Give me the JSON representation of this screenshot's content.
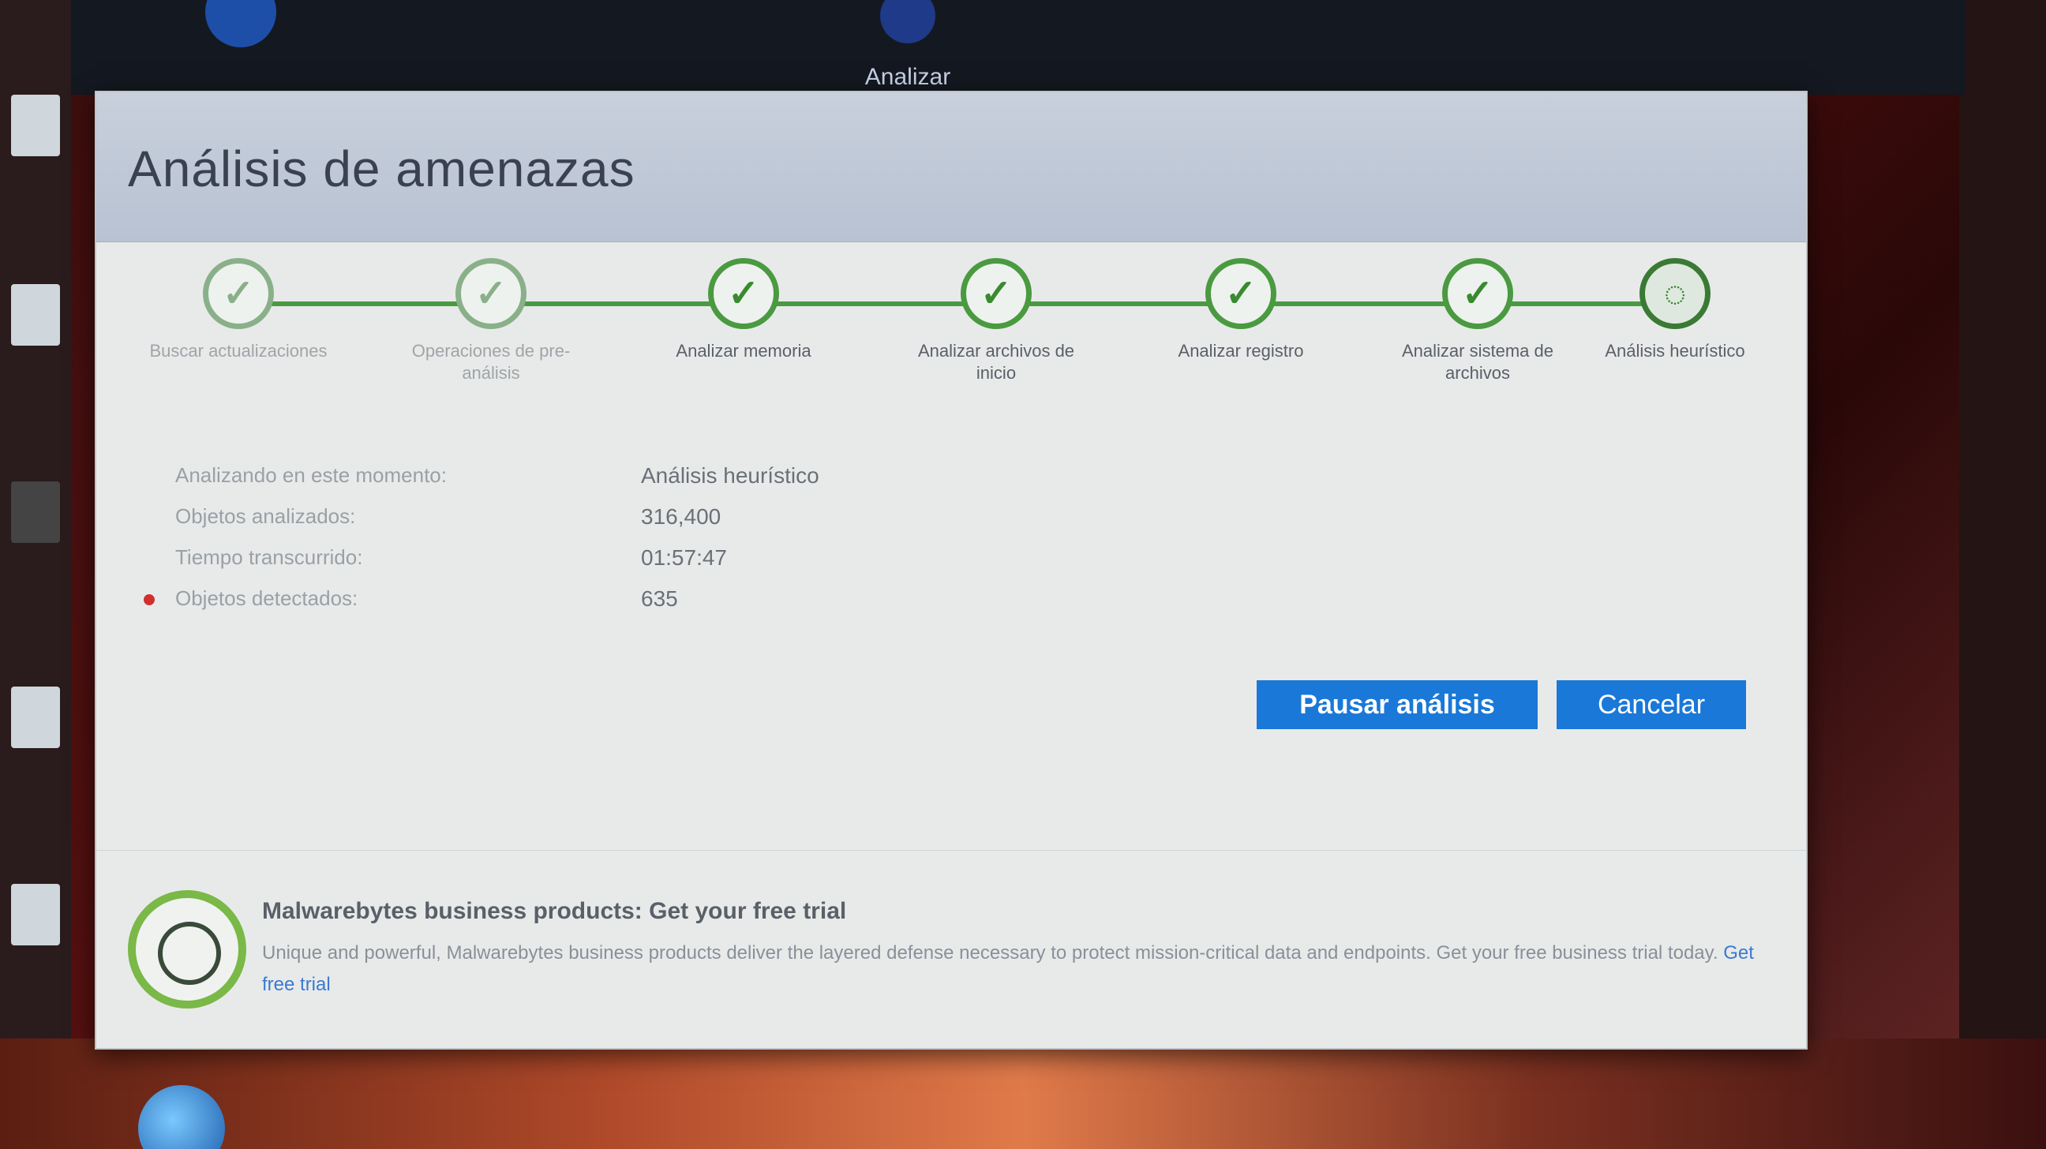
{
  "app": {
    "nav_scan_label": "Analizar"
  },
  "dialog": {
    "title": "Análisis de amenazas"
  },
  "steps": [
    {
      "label": "Buscar actualizaciones",
      "state": "done-faded"
    },
    {
      "label": "Operaciones de pre-análisis",
      "state": "done-faded"
    },
    {
      "label": "Analizar memoria",
      "state": "done"
    },
    {
      "label": "Analizar archivos de inicio",
      "state": "done"
    },
    {
      "label": "Analizar registro",
      "state": "done"
    },
    {
      "label": "Analizar sistema de archivos",
      "state": "done"
    },
    {
      "label": "Análisis heurístico",
      "state": "current"
    }
  ],
  "scan_info": {
    "current_label": "Analizando en este momento:",
    "current_value": "Análisis heurístico",
    "objects_label": "Objetos analizados:",
    "objects_value": "316,400",
    "time_label": "Tiempo transcurrido:",
    "time_value": "01:57:47",
    "detected_label": "Objetos detectados:",
    "detected_value": "635"
  },
  "buttons": {
    "pause": "Pausar análisis",
    "cancel": "Cancelar"
  },
  "promo": {
    "title": "Malwarebytes business products: Get your free trial",
    "text": "Unique and powerful, Malwarebytes business products deliver the layered defense necessary to protect mission-critical data and endpoints. Get your free business trial today.",
    "link": "Get free trial"
  },
  "colors": {
    "accent_blue": "#1a78d8",
    "step_green": "#4a9a40",
    "detected_dot": "#d03030"
  }
}
